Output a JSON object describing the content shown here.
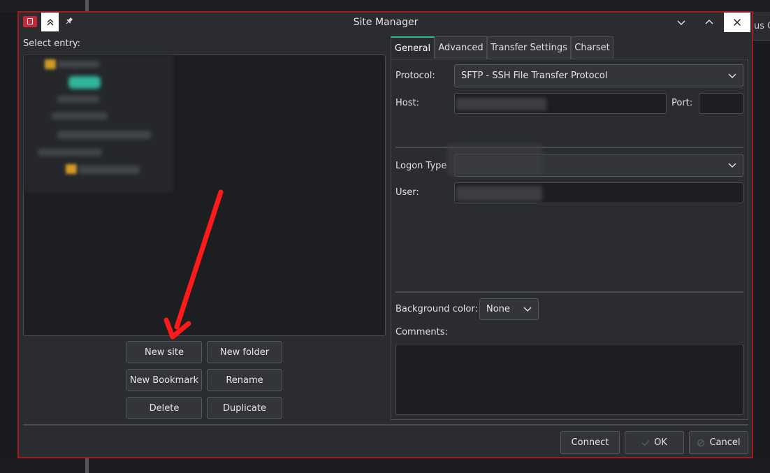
{
  "window": {
    "title": "Site Manager"
  },
  "background": {
    "right_text": "us O"
  },
  "left": {
    "select_label": "Select entry:",
    "buttons": {
      "new_site": "New site",
      "new_folder": "New folder",
      "new_bookmark": "New Bookmark",
      "rename": "Rename",
      "delete": "Delete",
      "duplicate": "Duplicate"
    }
  },
  "tabs": [
    {
      "label": "General",
      "active": true
    },
    {
      "label": "Advanced",
      "active": false
    },
    {
      "label": "Transfer Settings",
      "active": false
    },
    {
      "label": "Charset",
      "active": false
    }
  ],
  "general": {
    "protocol_label": "Protocol:",
    "protocol_value": "SFTP - SSH File Transfer Protocol",
    "host_label": "Host:",
    "host_value": "",
    "port_label": "Port:",
    "port_value": "",
    "logon_type_label": "Logon Type",
    "logon_type_value": "",
    "user_label": "User:",
    "user_value": "",
    "background_color_label": "Background color:",
    "background_color_value": "None",
    "comments_label": "Comments:",
    "comments_value": ""
  },
  "footer": {
    "connect": "Connect",
    "ok": "OK",
    "cancel": "Cancel"
  },
  "colors": {
    "accent": "#2fb69a",
    "window_border": "#a01c22",
    "annotation_arrow": "#ff1a1a"
  },
  "icons": {
    "app": "filezilla-icon",
    "keep_above": "keep-above-icon",
    "pin": "pin-icon",
    "minimize": "chevron-down-icon",
    "maximize": "chevron-up-icon",
    "close": "close-icon"
  }
}
